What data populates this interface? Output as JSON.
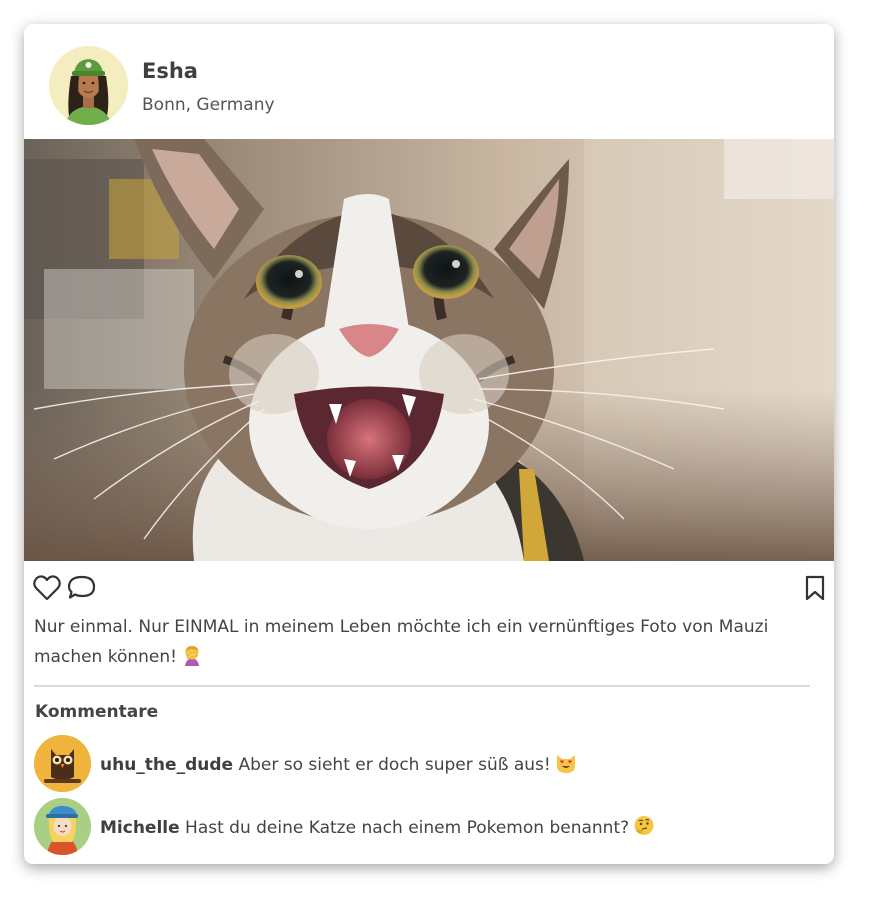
{
  "post": {
    "user": {
      "name": "Esha",
      "location": "Bonn, Germany",
      "avatar_icon": "woman-green-cap-avatar"
    },
    "image": {
      "subject": "cat-meowing-photo"
    },
    "actions": {
      "like_icon": "heart-outline-icon",
      "comment_icon": "speech-bubble-icon",
      "bookmark_icon": "bookmark-outline-icon"
    },
    "caption": {
      "text": "Nur einmal. Nur EINMAL in meinem Leben möchte ich ein vernünftiges Foto von Mauzi machen können!",
      "emoji": "🤦‍♀️"
    }
  },
  "comments": {
    "title": "Kommentare",
    "items": [
      {
        "user": "uhu_the_dude",
        "text": "Aber so sieht er doch super süß aus!",
        "emoji": "😻",
        "avatar_icon": "owl-avatar",
        "avatar_color": "#f0b33c"
      },
      {
        "user": "Michelle",
        "text": "Hast du deine Katze nach einem Pokemon benannt?",
        "emoji": "🤔",
        "avatar_icon": "girl-blue-cap-avatar",
        "avatar_color": "#a9cf85"
      }
    ]
  },
  "colors": {
    "text": "#444444",
    "divider": "#d9d9d9",
    "card_bg": "#ffffff"
  }
}
